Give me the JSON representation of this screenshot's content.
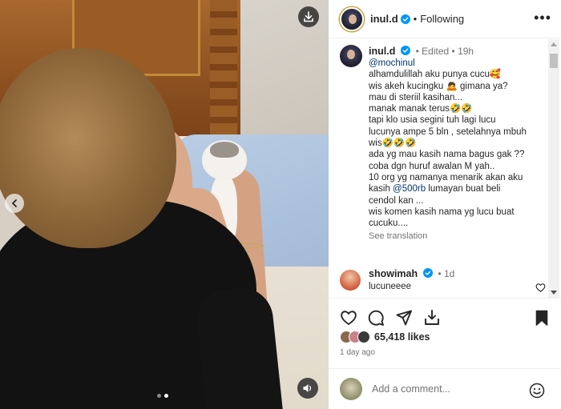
{
  "post": {
    "username": "inul.d",
    "follow_status": "Following",
    "separator": "•",
    "more_label": "•••"
  },
  "caption": {
    "username": "inul.d",
    "edited_label": "Edited",
    "time": "19h",
    "lines": [
      "@mochinul",
      "alhamdulillah aku punya cucu🥰",
      "wis akeh kucingku 🙇 gimana ya?",
      "mau di steriil kasihan...",
      "manak manak terus🤣🤣",
      "tapi klo usia segini tuh lagi lucu",
      "lucunya ampe 5 bln , setelahnya mbuh",
      "wis🤣🤣🤣",
      "ada yg mau kasih nama bagus gak ??",
      "coba dgn huruf awalan M yah..",
      "10 org yg namanya menarik akan aku",
      "kasih @500rb lumayan buat beli",
      "cendol kan ...",
      "wis komen kasih nama yg lucu buat",
      "cucuku...."
    ],
    "mention": "@mochinul",
    "mention2": "@500rb",
    "see_translation": "See translation"
  },
  "comment": {
    "username": "showimah",
    "time": "1d",
    "text": "lucuneeee"
  },
  "likes": {
    "count_text": "65,418 likes"
  },
  "time_ago": "1 day ago",
  "add_comment": {
    "placeholder": "Add a comment..."
  },
  "media": {
    "carousel_count": 2,
    "carousel_active": 2
  },
  "colors": {
    "verified": "#0095f6",
    "link": "#00376b",
    "muted": "#737373",
    "text": "#262626"
  },
  "icons": {
    "download": "download-icon",
    "mute": "volume-icon",
    "prev": "chevron-left-icon",
    "heart": "heart-icon",
    "comment": "comment-icon",
    "share": "send-icon",
    "save": "bookmark-icon",
    "emoji": "emoji-icon"
  }
}
